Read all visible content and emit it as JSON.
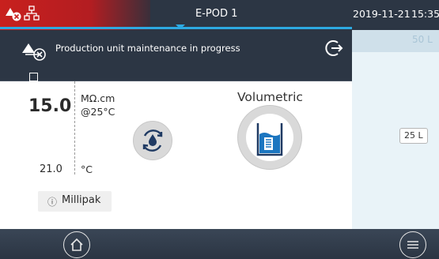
{
  "header": {
    "device_name": "E-POD 1",
    "date": "2019-11-21",
    "time": "15:35",
    "alert_icon": "maintenance-warning-icon",
    "network_icon": "network-icon"
  },
  "notification": {
    "icon": "maintenance-warning-icon",
    "message": "Production unit maintenance in progress",
    "action_icon": "logout-icon"
  },
  "tank": {
    "capacity": "50 L",
    "level": "25 L"
  },
  "resistivity": {
    "value": "15.0",
    "unit": "MΩ.cm",
    "reference": "@25°C"
  },
  "temperature": {
    "value": "21.0",
    "unit": "°C"
  },
  "consumable": {
    "info_symbol": "ⓘ",
    "label": "Millipak"
  },
  "dispense": {
    "recirculation_icon": "recirculation-drop-icon",
    "mode_label": "Volumetric",
    "mode_icon": "volumetric-dispense-icon"
  },
  "footer": {
    "home_icon": "home-icon",
    "menu_icon": "menu-icon"
  },
  "colors": {
    "alert_red": "#c8201e",
    "accent_blue": "#2da9e1",
    "dark_bar": "#2c3644"
  }
}
